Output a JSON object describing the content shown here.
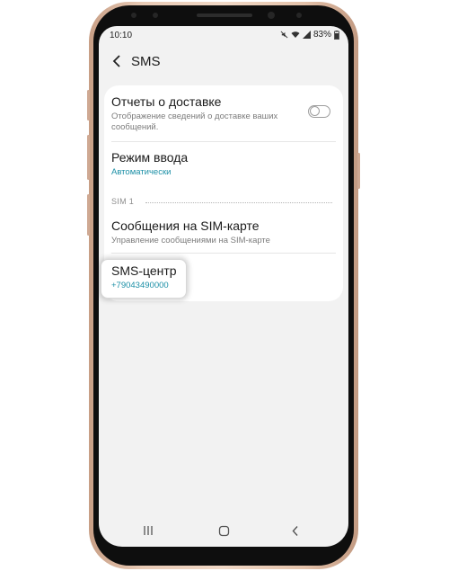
{
  "status_bar": {
    "time": "10:10",
    "battery": "83%"
  },
  "header": {
    "title": "SMS"
  },
  "settings": {
    "delivery_reports": {
      "title": "Отчеты о доставке",
      "subtitle_line1": "Отображение сведений о доставке ваших",
      "subtitle_line2": "сообщений.",
      "toggle_state": "off"
    },
    "input_mode": {
      "title": "Режим ввода",
      "value": "Автоматически"
    },
    "section_sim1": {
      "label": "SIM 1"
    },
    "sim_messages": {
      "title": "Сообщения на SIM-карте",
      "subtitle": "Управление сообщениями на SIM-карте"
    },
    "sms_center": {
      "title": "SMS-центр",
      "value": "+79043490000"
    }
  },
  "icons": [
    "back-arrow-icon",
    "mute-icon",
    "wifi-icon",
    "signal-icon",
    "battery-icon",
    "recent-apps-icon",
    "home-icon",
    "back-icon"
  ],
  "colors": {
    "accent": "#1b8fa6",
    "screen_background": "#f2f2f2",
    "card_background": "#ffffff"
  }
}
